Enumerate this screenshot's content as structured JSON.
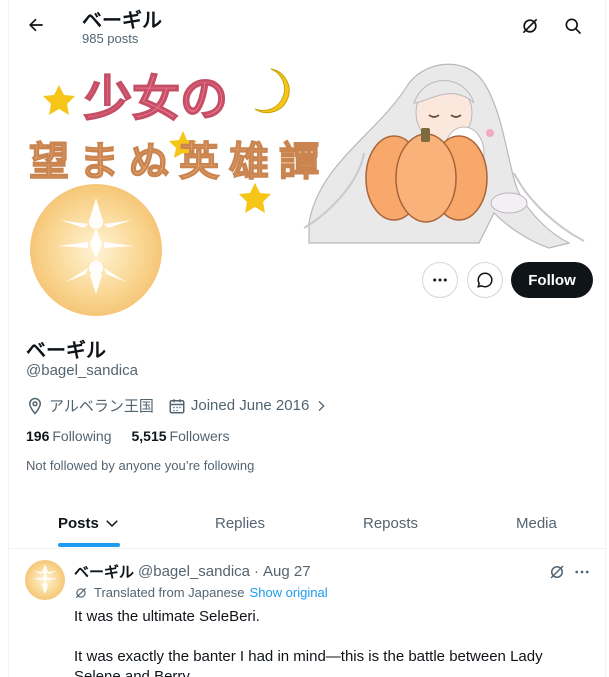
{
  "header": {
    "title": "ベーギル",
    "post_count": "985 posts"
  },
  "banner": {
    "art_text_line1": "少女の",
    "art_text_line2": "望まぬ英雄譚"
  },
  "profile": {
    "display_name": "ベーギル",
    "handle": "@bagel_sandica",
    "location": "アルベラン王国",
    "joined": "Joined June 2016",
    "following_count": "196",
    "following_label": "Following",
    "followers_count": "5,515",
    "followers_label": "Followers",
    "not_followed": "Not followed by anyone you’re following",
    "follow_label": "Follow"
  },
  "tabs": [
    {
      "label": "Posts",
      "active": true
    },
    {
      "label": "Replies",
      "active": false
    },
    {
      "label": "Reposts",
      "active": false
    },
    {
      "label": "Media",
      "active": false
    }
  ],
  "post": {
    "name": "ベーギル",
    "handle": "@bagel_sandica",
    "separator": "·",
    "date": "Aug 27",
    "translated": "Translated from Japanese",
    "show_original": "Show original",
    "text1": "It was the ultimate SeleBeri.",
    "text2": "It was exactly the banter I had in mind—this is the battle between Lady Selene and Berry."
  },
  "icons": {
    "back": "arrow-left-icon",
    "grok": "grok-icon",
    "search": "search-icon",
    "more": "more-icon",
    "message": "message-icon",
    "location": "location-pin-icon",
    "calendar": "calendar-icon",
    "chevron": "chevron-right-icon",
    "posts_dropdown": "chevron-down-icon",
    "translate": "translate-icon"
  },
  "colors": {
    "accent": "#1d9bf0",
    "text": "#0f1419",
    "secondary": "#536471",
    "follow_bg": "#0f1419"
  }
}
